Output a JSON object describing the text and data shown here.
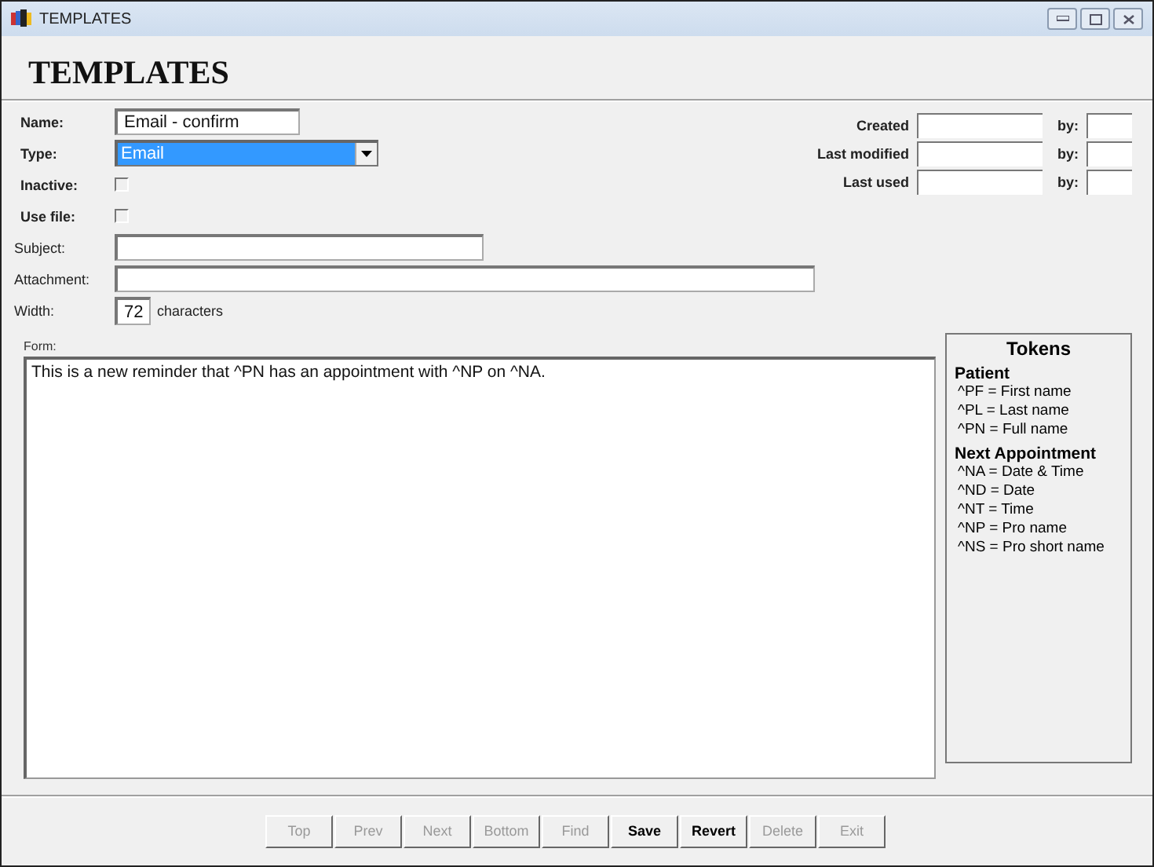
{
  "window": {
    "title": "TEMPLATES"
  },
  "heading": "TEMPLATES",
  "fields": [
    {
      "kind": "text",
      "label": "Name:",
      "bold": true,
      "value": "Email - confirm"
    },
    {
      "kind": "select",
      "label": "Type:",
      "bold": true,
      "value": "Email"
    },
    {
      "kind": "checkbox",
      "label": "Inactive:",
      "bold": true,
      "checked": false
    },
    {
      "kind": "checkbox",
      "label": "Use file:",
      "bold": true,
      "checked": false
    },
    {
      "kind": "text",
      "label": "Subject:",
      "bold": false
    },
    {
      "kind": "text",
      "label": "Attachment:",
      "bold": false
    },
    {
      "kind": "width",
      "label": "Width:",
      "bold": false,
      "value": "72",
      "suffix": "characters"
    }
  ],
  "dates": [
    {
      "label": "Created",
      "by": "by:"
    },
    {
      "label": "Last modified",
      "by": "by:"
    },
    {
      "label": "Last used",
      "by": "by:"
    }
  ],
  "form": {
    "label": "Form:",
    "value": "This is a new reminder that ^PN has an appointment with ^NP on ^NA."
  },
  "tokens": {
    "title": "Tokens",
    "groups": [
      {
        "title": "Patient",
        "items": [
          "^PF = First name",
          "^PL = Last name",
          "^PN = Full name"
        ]
      },
      {
        "title": "Next Appointment",
        "items": [
          "^NA = Date & Time",
          "^ND = Date",
          "^NT = Time",
          "^NP = Pro name",
          "^NS = Pro short name"
        ]
      }
    ]
  },
  "buttons": [
    {
      "label": "Top",
      "disabled": true
    },
    {
      "label": "Prev",
      "disabled": true
    },
    {
      "label": "Next",
      "disabled": true
    },
    {
      "label": "Bottom",
      "disabled": true
    },
    {
      "label": "Find",
      "disabled": true
    },
    {
      "label": "Save",
      "disabled": false
    },
    {
      "label": "Revert",
      "disabled": false
    },
    {
      "label": "Delete",
      "disabled": true
    },
    {
      "label": "Exit",
      "disabled": true
    }
  ]
}
